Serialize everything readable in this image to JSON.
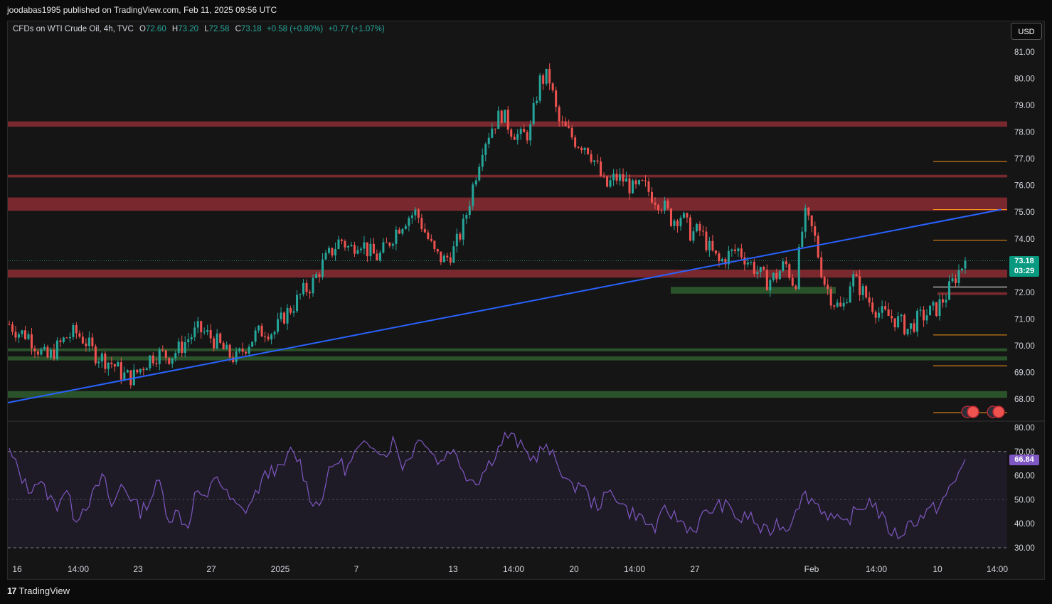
{
  "header": {
    "publisher": "joodabas1995 published on TradingView.com, Feb 11, 2025 09:56 UTC"
  },
  "legend": {
    "symbol": "CFDs on WTI Crude Oil, 4h, TVC",
    "o_label": "O",
    "o": "72.60",
    "h_label": "H",
    "h": "73.20",
    "l_label": "L",
    "l": "72.58",
    "c_label": "C",
    "c": "73.18",
    "change": "+0.58 (+0.80%)",
    "change2": "+0.77 (+1.07%)"
  },
  "currency": "USD",
  "price_badge": {
    "price": "73.18",
    "countdown": "03:29"
  },
  "rsi_badge": "66.84",
  "footer": {
    "brand": "TradingView"
  },
  "colors": {
    "up": "#26a69a",
    "down": "#ef5350",
    "trendline": "#2962ff",
    "rsi": "#7e57c2",
    "resistance": "#8b2c33",
    "support": "#2e5a2e",
    "levels": "#f7931a"
  },
  "chart_data": {
    "type": "candlestick",
    "price_axis": {
      "ticks": [
        "81.00",
        "80.00",
        "79.00",
        "78.00",
        "77.00",
        "76.00",
        "75.00",
        "74.00",
        "73.00",
        "72.00",
        "71.00",
        "70.00",
        "69.00",
        "68.00"
      ],
      "ylim": [
        67.5,
        81.5
      ]
    },
    "time_axis": {
      "labels": [
        "16",
        "14:00",
        "23",
        "27",
        "2025",
        "7",
        "13",
        "14:00",
        "20",
        "14:00",
        "27",
        "Feb",
        "14:00",
        "10",
        "14:00"
      ]
    },
    "close_path": [
      70.8,
      70.5,
      70.4,
      69.9,
      69.5,
      69.9,
      70.3,
      70.5,
      70.2,
      69.7,
      69.5,
      69.3,
      68.9,
      68.8,
      69.2,
      69.6,
      69.7,
      69.6,
      69.9,
      70.3,
      70.6,
      70.4,
      70.1,
      69.7,
      69.5,
      70.0,
      70.4,
      70.6,
      70.5,
      71.1,
      71.5,
      72.0,
      72.3,
      73.0,
      73.5,
      74.0,
      73.6,
      74.0,
      73.5,
      73.3,
      73.8,
      74.4,
      74.8,
      75.0,
      74.2,
      73.4,
      73.2,
      73.6,
      74.5,
      76.0,
      77.5,
      78.2,
      78.7,
      78.1,
      77.8,
      78.0,
      79.9,
      80.1,
      78.4,
      78.0,
      77.6,
      77.5,
      76.8,
      75.9,
      76.3,
      76.2,
      75.8,
      76.0,
      75.6,
      75.3,
      74.7,
      74.9,
      74.2,
      74.3,
      73.6,
      73.1,
      73.4,
      73.6,
      73.2,
      72.8,
      72.4,
      72.6,
      73.1,
      72.2,
      74.9,
      74.2,
      72.5,
      71.7,
      71.3,
      72.6,
      72.1,
      71.6,
      71.2,
      71.1,
      70.9,
      70.6,
      71.0,
      71.2,
      71.4,
      71.9,
      72.6,
      73.18
    ],
    "resistance_zones": [
      [
        78.2,
        78.4
      ],
      [
        76.3,
        76.4
      ],
      [
        75.05,
        75.55
      ],
      [
        72.55,
        72.85
      ],
      [
        71.9,
        72.0
      ]
    ],
    "support_zones": [
      [
        71.95,
        72.2
      ],
      [
        69.8,
        69.9
      ],
      [
        69.45,
        69.6
      ],
      [
        68.05,
        68.3
      ]
    ],
    "level_lines": [
      76.9,
      75.1,
      73.95,
      72.2,
      70.4,
      69.25,
      67.5
    ],
    "trendline": {
      "from": [
        0,
        67.8
      ],
      "to": [
        1,
        75.1
      ]
    },
    "rsi": {
      "ticks": [
        "80.00",
        "70.00",
        "60.00",
        "50.00",
        "40.00",
        "30.00"
      ],
      "ylim": [
        25,
        82
      ],
      "bands": [
        70,
        30
      ],
      "midline": 50,
      "values": [
        70,
        62,
        54,
        58,
        53,
        47,
        55,
        42,
        47,
        52,
        60,
        46,
        57,
        51,
        45,
        50,
        58,
        42,
        45,
        38,
        55,
        48,
        62,
        53,
        48,
        45,
        50,
        58,
        63,
        62,
        70,
        66,
        52,
        47,
        60,
        67,
        62,
        70,
        72,
        74,
        68,
        75,
        64,
        70,
        77,
        70,
        65,
        72,
        66,
        59,
        58,
        64,
        70,
        77,
        75,
        70,
        67,
        72,
        68,
        62,
        54,
        58,
        49,
        48,
        53,
        51,
        45,
        44,
        40,
        38,
        46,
        43,
        40,
        37,
        43,
        46,
        48,
        46,
        41,
        44,
        38,
        36,
        41,
        37,
        48,
        52,
        49,
        45,
        42,
        39,
        44,
        47,
        50,
        43,
        37,
        35,
        40,
        42,
        45,
        47,
        52,
        58,
        66.84
      ]
    }
  }
}
